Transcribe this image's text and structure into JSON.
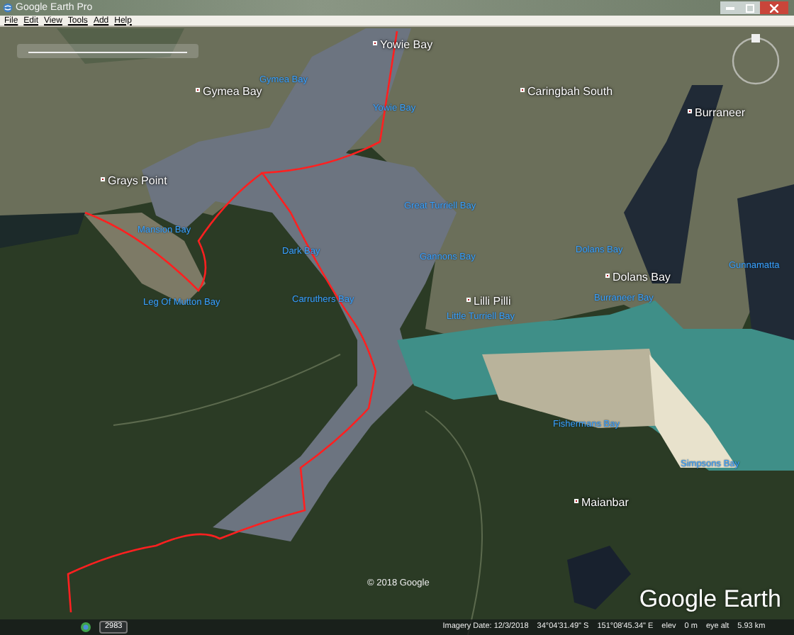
{
  "window": {
    "title": "Google Earth Pro"
  },
  "menu": [
    {
      "label": "File"
    },
    {
      "label": "Edit"
    },
    {
      "label": "View"
    },
    {
      "label": "Tools"
    },
    {
      "label": "Add"
    },
    {
      "label": "Help"
    }
  ],
  "map": {
    "places": [
      {
        "name": "Yowie Bay",
        "kind": "town"
      },
      {
        "name": "Gymea Bay",
        "kind": "bay"
      },
      {
        "name": "Gymea Bay",
        "kind": "town"
      },
      {
        "name": "Caringbah South",
        "kind": "town"
      },
      {
        "name": "Yowie Bay",
        "kind": "bay"
      },
      {
        "name": "Burraneer",
        "kind": "town"
      },
      {
        "name": "Grays Point",
        "kind": "town"
      },
      {
        "name": "Great Turriell Bay",
        "kind": "bay"
      },
      {
        "name": "Mansion Bay",
        "kind": "bay"
      },
      {
        "name": "Dolans Bay",
        "kind": "bay"
      },
      {
        "name": "Dark Bay",
        "kind": "bay"
      },
      {
        "name": "Gannons Bay",
        "kind": "bay"
      },
      {
        "name": "Gunnamatta",
        "kind": "bay"
      },
      {
        "name": "Dolans Bay",
        "kind": "town"
      },
      {
        "name": "Leg Of Mutton Bay",
        "kind": "bay"
      },
      {
        "name": "Carruthers Bay",
        "kind": "bay"
      },
      {
        "name": "Lilli Pilli",
        "kind": "town"
      },
      {
        "name": "Burraneer Bay",
        "kind": "bay"
      },
      {
        "name": "Little Turriell Bay",
        "kind": "bay"
      },
      {
        "name": "Fishermans Bay",
        "kind": "bay"
      },
      {
        "name": "Simpsons Bay",
        "kind": "bay"
      },
      {
        "name": "Maianbar",
        "kind": "town"
      }
    ],
    "copyright": "© 2018 Google",
    "logo": "Google Earth",
    "layer_count": "2983"
  },
  "status_bar": {
    "imagery_date": "Imagery Date: 12/3/2018",
    "latitude": "34°04'31.49\" S",
    "longitude": "151°08'45.34\" E",
    "elev_label": "elev",
    "elev": "0 m",
    "eye_alt_label": "eye alt",
    "eye_alt": "5.93 km"
  }
}
